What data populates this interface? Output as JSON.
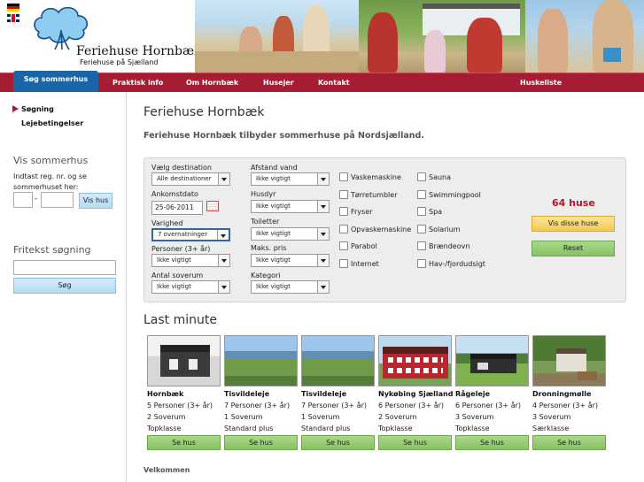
{
  "header": {
    "brand": "Feriehuse Hornbæk",
    "subtitle": "Feriehuse på Sjælland"
  },
  "nav": {
    "items": [
      "Søg sommerhus",
      "Praktisk info",
      "Om Hornbæk",
      "Husejer",
      "Kontakt",
      "Huskeliste"
    ]
  },
  "sidebar": {
    "links": [
      "Søgning",
      "Lejebetingelser"
    ],
    "vis_title": "Vis sommerhus",
    "vis_help": "Indtast reg. nr. og se sommerhuset her:",
    "dash": "-",
    "vis_button": "Vis hus",
    "fritekst_title": "Fritekst søgning",
    "search_button": "Søg"
  },
  "main": {
    "title": "Feriehuse Hornbæk",
    "intro": "Feriehuse Hornbæk tilbyder sommerhuse på Nordsjælland."
  },
  "search": {
    "destination_label": "Vælg destination",
    "destination_value": "Alle destinationer",
    "arrival_label": "Ankomstdato",
    "arrival_value": "25-06-2011",
    "duration_label": "Varighed",
    "duration_value": "7 overnatninger",
    "persons_label": "Personer (3+ år)",
    "persons_value": "Ikke vigtigt",
    "rooms_label": "Antal soverum",
    "rooms_value": "Ikke vigtigt",
    "water_label": "Afstand vand",
    "water_value": "Ikke vigtigt",
    "pets_label": "Husdyr",
    "pets_value": "Ikke vigtigt",
    "toilets_label": "Toiletter",
    "toilets_value": "Ikke vigtigt",
    "price_label": "Maks. pris",
    "price_value": "Ikke vigtigt",
    "category_label": "Kategori",
    "category_value": "Ikke vigtigt",
    "amenities_col1": [
      "Vaskemaskine",
      "Tørretumbler",
      "Fryser",
      "Opvaskemaskine",
      "Parabol",
      "Internet"
    ],
    "amenities_col2": [
      "Sauna",
      "Swimmingpool",
      "Spa",
      "Solarium",
      "Brændeovn",
      "Hav-/fjordudsigt"
    ],
    "count": "64 huse",
    "show_button": "Vis disse huse",
    "reset_button": "Reset"
  },
  "last_minute": {
    "title": "Last minute",
    "button": "Se hus",
    "cards": [
      {
        "name": "Hornbæk",
        "persons": "5 Personer (3+ år)",
        "rooms": "2 Soverum",
        "class": "Topklasse"
      },
      {
        "name": "Tisvildeleje",
        "persons": "7 Personer (3+ år)",
        "rooms": "1 Soverum",
        "class": "Standard plus"
      },
      {
        "name": "Tisvildeleje",
        "persons": "7 Personer (3+ år)",
        "rooms": "1 Soverum",
        "class": "Standard plus"
      },
      {
        "name": "Nykøbing Sjælland",
        "persons": "6 Personer (3+ år)",
        "rooms": "2 Soverum",
        "class": "Topklasse"
      },
      {
        "name": "Rågeleje",
        "persons": "6 Personer (3+ år)",
        "rooms": "3 Soverum",
        "class": "Topklasse"
      },
      {
        "name": "Dronningmølle",
        "persons": "4 Personer (3+ år)",
        "rooms": "3 Soverum",
        "class": "Særklasse"
      }
    ]
  },
  "footer": {
    "welcome": "Velkommen"
  },
  "colors": {
    "nav_bg": "#a51d33",
    "nav_active": "#1a64a8",
    "count": "#b2182b",
    "green_button": "#86c262",
    "yellow_button": "#f3c84e"
  }
}
